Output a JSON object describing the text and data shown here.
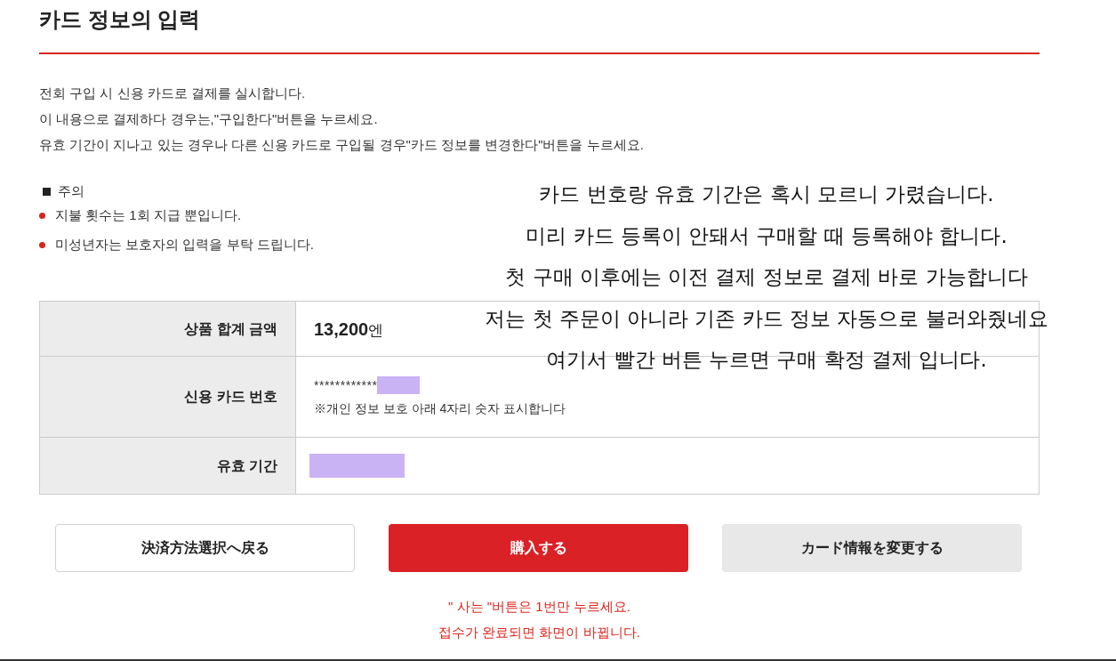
{
  "heading": "카드 정보의 입력",
  "intro": [
    "전회 구입 시 신용 카드로 결제를 실시합니다.",
    "이 내용으로 결제하다 경우는,\"구입한다\"버튼을 누르세요.",
    "유효 기간이 지나고 있는 경우나 다른 신용 카드로 구입될 경우\"카드 정보를 변경한다\"버튼을 누르세요."
  ],
  "notice": {
    "title": "주의",
    "items": [
      "지불 횟수는 1회 지급 뿐입니다.",
      "미성년자는 보호자의 입력을 부탁 드립니다."
    ]
  },
  "summary_table": {
    "rows": [
      {
        "kind": "amount",
        "label": "상품 합계 금액",
        "amount": "13,200",
        "unit": "엔"
      },
      {
        "kind": "card",
        "label": "신용 카드 번호",
        "masked_number": "************",
        "note": "※개인 정보 보호 아래 4자리 숫자 표시합니다"
      },
      {
        "kind": "expiry",
        "label": "유효 기간"
      }
    ]
  },
  "buttons": [
    {
      "kind": "outline",
      "label": "決済方法選択へ戻る"
    },
    {
      "kind": "primary",
      "label": "購入する"
    },
    {
      "kind": "secondary",
      "label": "カード情報を変更する"
    }
  ],
  "warning": [
    "\" 사는 \"버튼은 1번만 누르세요.",
    "접수가 완료되면 화면이 바뀝니다."
  ],
  "annotation": [
    "카드 번호랑 유효 기간은 혹시 모르니 가렸습니다.",
    "미리 카드 등록이 안돼서 구매할 때 등록해야 합니다.",
    "첫 구매 이후에는 이전 결제 정보로 결제 바로 가능합니다",
    "저는 첫 주문이 아니라 기존 카드 정보 자동으로 불러와줬네요",
    "여기서 빨간 버튼 누르면 구매 확정 결제 입니다."
  ]
}
